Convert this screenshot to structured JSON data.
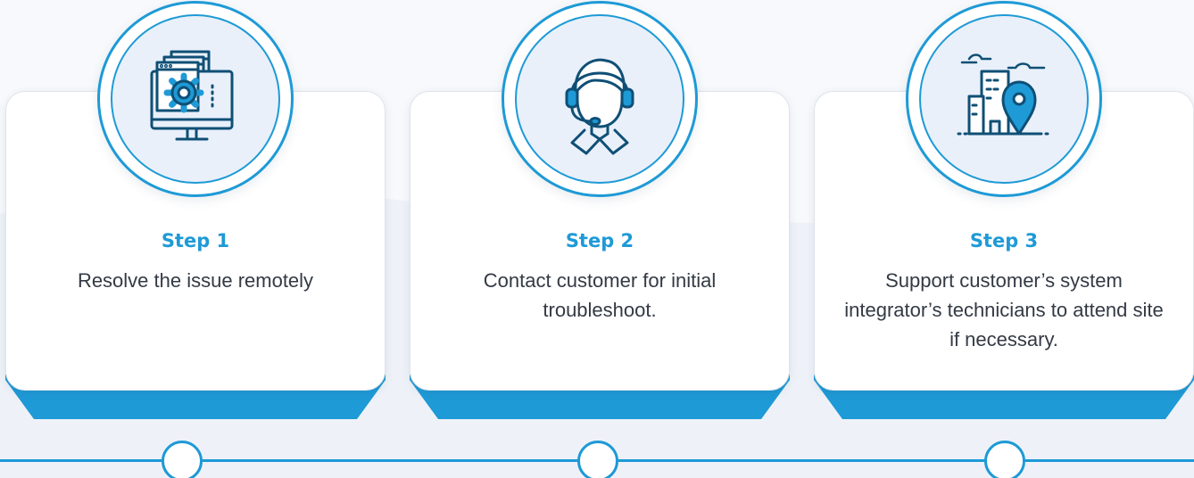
{
  "colors": {
    "accent": "#1e9ad6",
    "accent_dark": "#1a86c0",
    "icon_stroke": "#0f4f75",
    "circle_fill": "#e9f0fa",
    "text": "#333a44"
  },
  "steps": [
    {
      "title": "Step 1",
      "description": "Resolve the issue remotely",
      "icon": "computer-gear-icon"
    },
    {
      "title": "Step 2",
      "description": "Contact customer for initial troubleshoot.",
      "icon": "headset-agent-icon"
    },
    {
      "title": "Step 3",
      "description": "Support customer’s system integrator’s technicians to attend site if necessary.",
      "icon": "building-location-pin-icon"
    }
  ]
}
